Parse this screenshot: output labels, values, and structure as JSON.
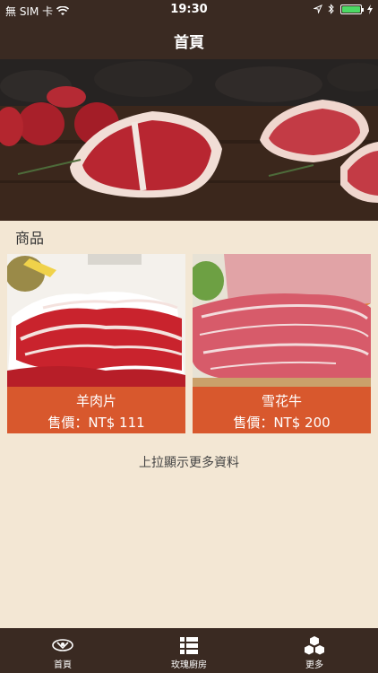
{
  "status_bar": {
    "carrier": "無 SIM 卡",
    "time": "19:30",
    "battery_level": 1.0
  },
  "nav": {
    "title": "首頁"
  },
  "section": {
    "title": "商品"
  },
  "products": [
    {
      "name": "羊肉片",
      "price": "售價：NT$ 111"
    },
    {
      "name": "雪花牛",
      "price": "售價：NT$ 200"
    }
  ],
  "load_more": "上拉顯示更多資料",
  "tabs": [
    {
      "label": "首頁",
      "icon": "home-icon"
    },
    {
      "label": "玫瑰廚房",
      "icon": "list-icon"
    },
    {
      "label": "更多",
      "icon": "boxes-icon"
    }
  ],
  "colors": {
    "bar_bg": "#3a2a22",
    "page_bg": "#f3e7d4",
    "accent": "#d8582d"
  }
}
